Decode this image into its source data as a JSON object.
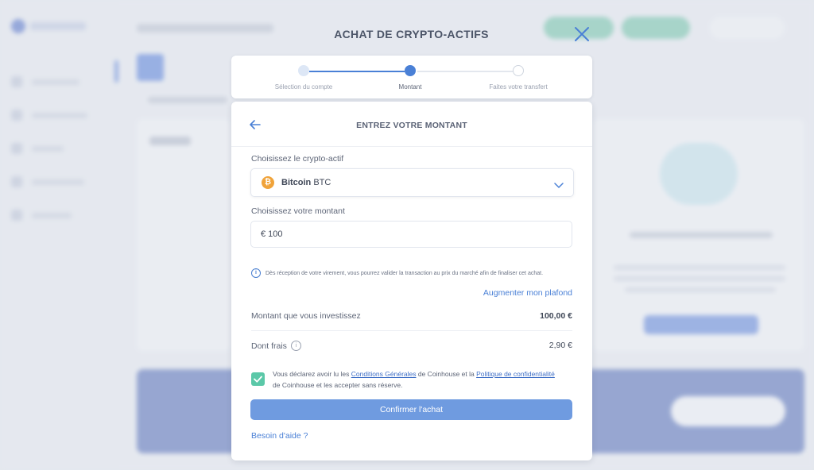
{
  "modal": {
    "title": "ACHAT DE CRYPTO-ACTIFS",
    "steps": [
      {
        "label": "Sélection du compte",
        "state": "done"
      },
      {
        "label": "Montant",
        "state": "active"
      },
      {
        "label": "Faites votre transfert",
        "state": "pending"
      }
    ]
  },
  "panel": {
    "title": "ENTREZ VOTRE MONTANT",
    "crypto_label": "Choisissez le crypto-actif",
    "crypto_name": "Bitcoin",
    "crypto_ticker": "BTC",
    "amount_label": "Choisissez votre montant",
    "amount_value": "€ 100",
    "info_text": "Dès réception de votre virement, vous pourrez valider la transaction au prix du marché afin de finaliser cet achat.",
    "raise_limit_link": "Augmenter mon plafond",
    "invest_label": "Montant que vous investissez",
    "invest_value": "100,00 €",
    "fees_label": "Dont frais",
    "fees_value": "2,90 €",
    "terms": {
      "part1": "Vous déclarez avoir lu les ",
      "link1": "Conditions Générales",
      "part2": " de Coinhouse et la ",
      "link2": "Politique de confidentialité",
      "part3": " de Coinhouse et les accepter sans réserve.",
      "checked": true
    },
    "confirm_button": "Confirmer l'achat",
    "help_link": "Besoin d'aide ?"
  },
  "colors": {
    "accent": "#4a80d6",
    "check": "#5bc8a8",
    "confirm": "#6f9be0",
    "bitcoin": "#f0a33a"
  }
}
